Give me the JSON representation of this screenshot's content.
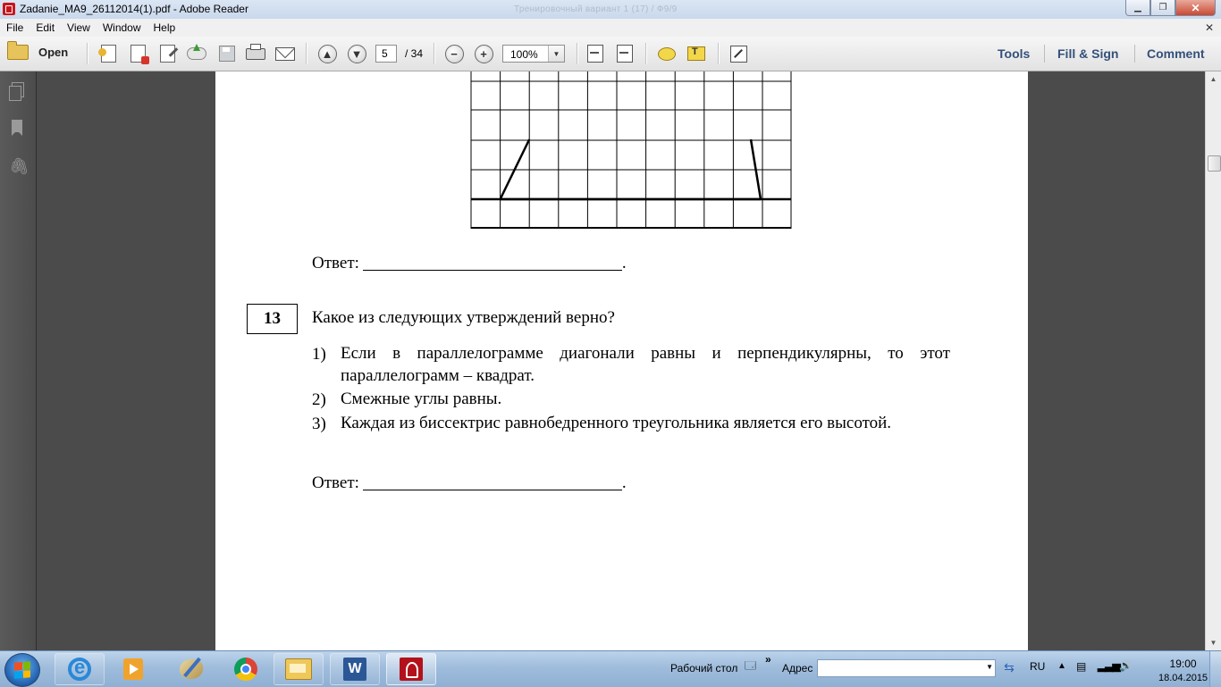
{
  "window": {
    "title": "Zadanie_MA9_26112014(1).pdf - Adobe Reader",
    "ghost_title": "Тренировочный вариант 1 (17) / Ф9/9",
    "colors": {
      "close_button": "#c84a33",
      "acrobat_red": "#c8161d"
    }
  },
  "menu": [
    "File",
    "Edit",
    "View",
    "Window",
    "Help"
  ],
  "toolbar": {
    "open_label": "Open",
    "page_current": "5",
    "page_total": "/ 34",
    "zoom_value": "100%",
    "panels": {
      "tools": "Tools",
      "fill_sign": "Fill & Sign",
      "comment": "Comment"
    },
    "panel_color": "#34507a"
  },
  "document": {
    "answer_label": "Ответ:",
    "answer_end": ".",
    "question_number": "13",
    "question_text": "Какое из следующих утверждений верно?",
    "options": [
      {
        "n": "1)",
        "text": "Если в параллелограмме диагонали равны и перпендикулярны, то этот параллелограмм – квадрат."
      },
      {
        "n": "2)",
        "text": "Смежные углы равны."
      },
      {
        "n": "3)",
        "text": "Каждая из биссектрис равнобедренного треугольника является его высотой."
      }
    ]
  },
  "taskbar": {
    "desktop_label": "Рабочий стол",
    "chevron": "»",
    "address_label": "Адрес",
    "address_value": "",
    "lang": "RU",
    "time": "19:00",
    "date": "18.04.2015",
    "apps": [
      "internet-explorer",
      "media-player",
      "paint",
      "chrome",
      "explorer",
      "word",
      "acrobat"
    ]
  }
}
